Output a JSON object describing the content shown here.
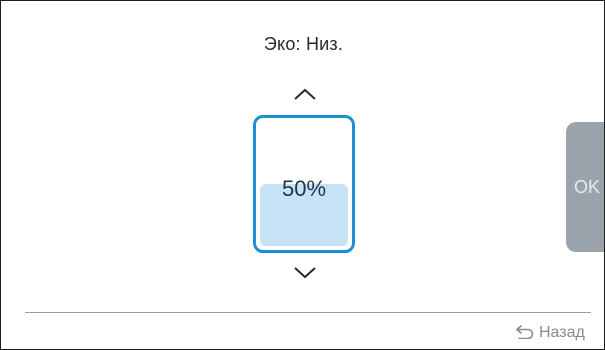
{
  "header": {
    "mode_title": "Эко: Низ."
  },
  "level": {
    "value_text": "50%",
    "fill_fraction": 0.5
  },
  "actions": {
    "ok_label": "OK",
    "back_label": "Назад"
  },
  "icons": {
    "up": "chevron-up-icon",
    "down": "chevron-down-icon",
    "back": "back-arrow-icon"
  },
  "colors": {
    "accent": "#1e8fd6",
    "fill": "#c6e3f6",
    "ok_button_bg": "#9aa3ab"
  }
}
